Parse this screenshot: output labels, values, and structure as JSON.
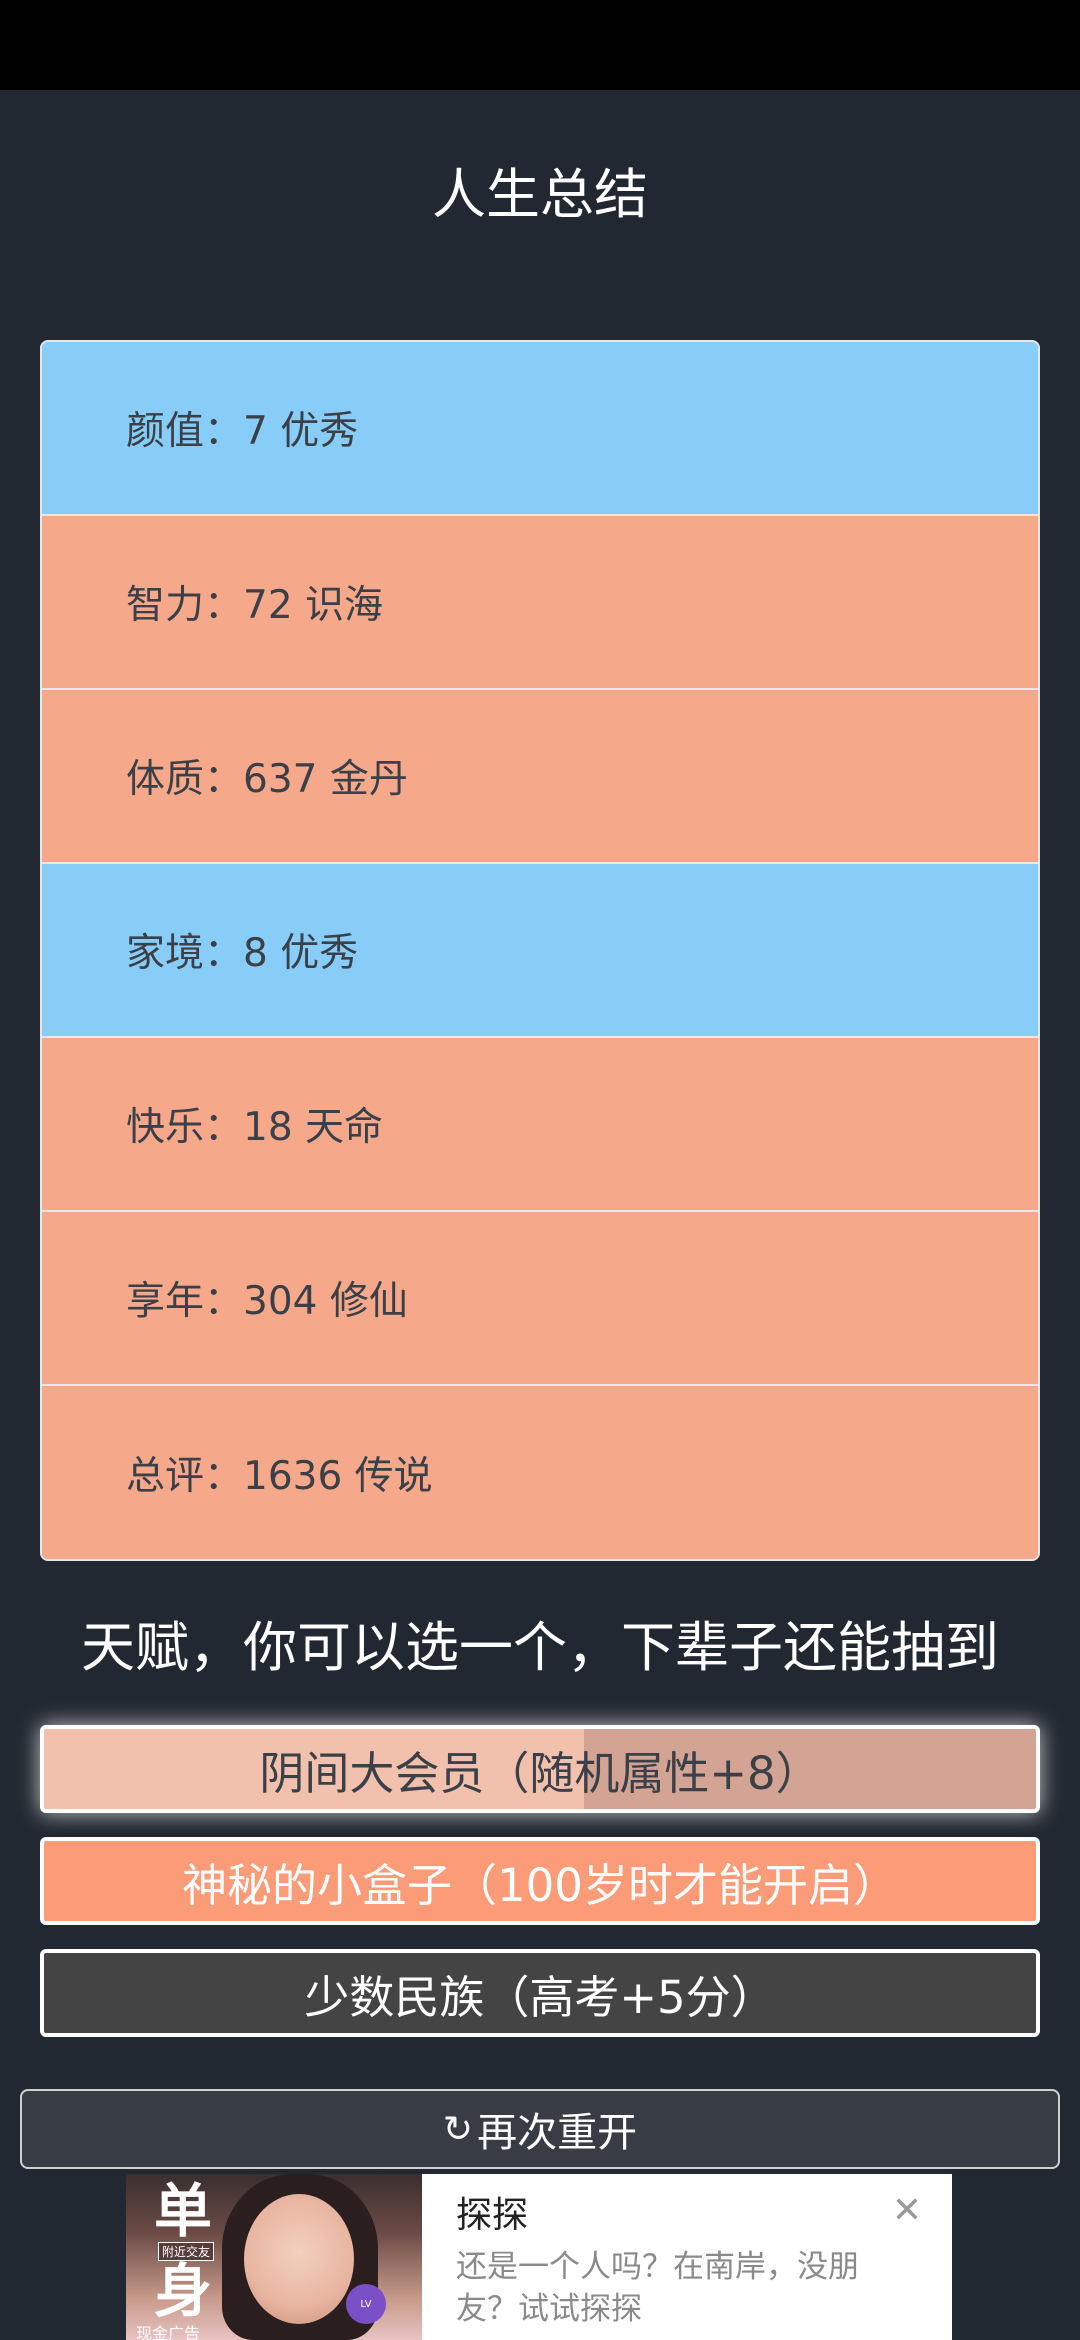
{
  "header": {
    "title": "人生总结"
  },
  "stats": [
    {
      "text": "颜值：7 优秀",
      "color": "blue"
    },
    {
      "text": "智力：72 识海",
      "color": "orange"
    },
    {
      "text": "体质：637 金丹",
      "color": "orange"
    },
    {
      "text": "家境：8 优秀",
      "color": "blue"
    },
    {
      "text": "快乐：18 天命",
      "color": "orange"
    },
    {
      "text": "享年：304 修仙",
      "color": "orange"
    },
    {
      "text": "总评：1636 传说",
      "color": "orange"
    }
  ],
  "talents": {
    "title": "天赋，你可以选一个，下辈子还能抽到",
    "options": [
      {
        "label": "阴间大会员（随机属性+8）"
      },
      {
        "label": "神秘的小盒子（100岁时才能开启）"
      },
      {
        "label": "少数民族（高考+5分）"
      }
    ]
  },
  "restart": {
    "icon": "refresh-icon",
    "label": "再次重开"
  },
  "ad": {
    "image_text_1": "单",
    "image_text_2": "身",
    "badge": "附近交友",
    "orb_text": "LV",
    "small_text": "现金广告",
    "title": "探探",
    "description": "还是一个人吗？在南岸，没朋友？试试探探",
    "close_icon": "close-icon"
  },
  "colors": {
    "background": "#222831",
    "stat_blue": "#88cdf8",
    "stat_orange": "#f5a98a",
    "talent_selected": "#f1c1ad",
    "talent_orange": "#fb9b78",
    "talent_dark": "#444444"
  }
}
